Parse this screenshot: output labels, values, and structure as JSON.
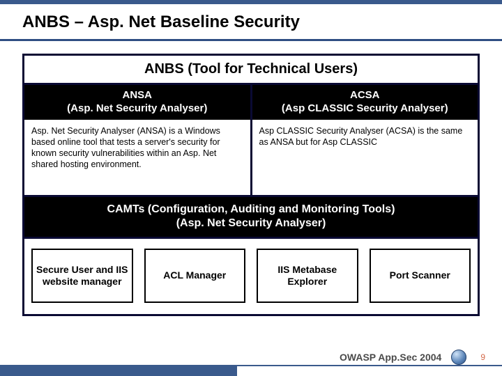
{
  "title": "ANBS – Asp. Net Baseline Security",
  "banner": "ANBS (Tool for Technical Users)",
  "ansa": {
    "head1": "ANSA",
    "head2": "(Asp. Net Security Analyser)",
    "body": "Asp. Net Security Analyser (ANSA) is a Windows based online tool that tests a server's security for known security vulnerabilities within an Asp. Net shared hosting environment."
  },
  "acsa": {
    "head1": "ACSA",
    "head2": "(Asp CLASSIC Security Analyser)",
    "body": "Asp CLASSIC Security Analyser (ACSA) is the same as ANSA but for Asp CLASSIC"
  },
  "camts": {
    "line1": "CAMTs (Configuration, Auditing and Monitoring Tools)",
    "line2": "(Asp. Net Security Analyser)"
  },
  "tools": [
    "Secure User and IIS website manager",
    "ACL  Manager",
    "IIS Metabase Explorer",
    "Port Scanner"
  ],
  "footer": {
    "label": "OWASP App.Sec 2004",
    "page": "9"
  }
}
